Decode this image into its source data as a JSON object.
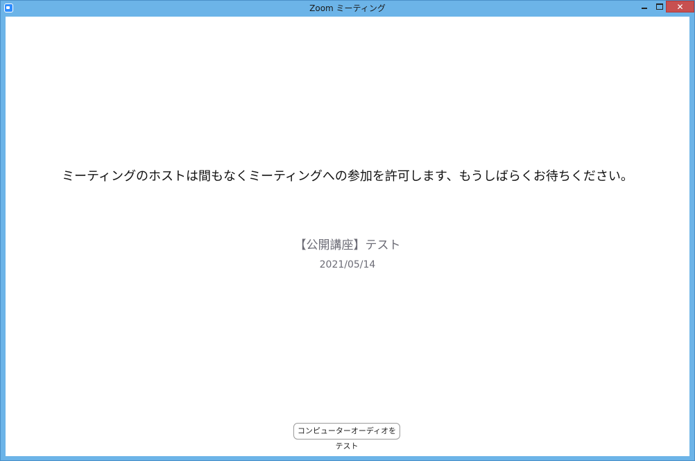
{
  "window": {
    "title": "Zoom ミーティング",
    "controls": {
      "minimize_icon": "minimize-icon",
      "maximize_icon": "maximize-icon",
      "close_icon": "close-icon",
      "close_glyph": "✕"
    },
    "colors": {
      "titlebar": "#6cb4e8",
      "close_button": "#c75050"
    }
  },
  "main": {
    "waiting_message": "ミーティングのホストは間もなくミーティングへの参加を許可します、もうしばらくお待ちください。",
    "meeting_title": "【公開講座】テスト",
    "meeting_date": "2021/05/14",
    "test_audio_button_label": "コンピューターオーディオをテスト"
  }
}
